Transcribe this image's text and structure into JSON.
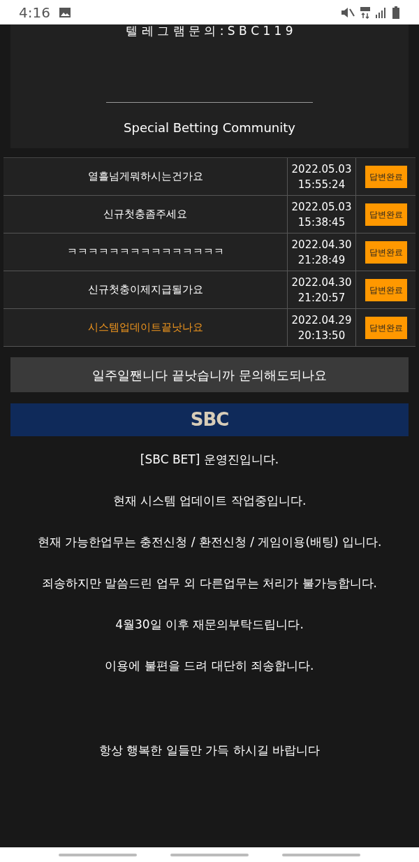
{
  "status_bar": {
    "time": "4:16"
  },
  "header": {
    "telegram": "텔 레 그 램 문 의 : S B C 1 1 9",
    "tagline": "Special Betting Community"
  },
  "inquiries": [
    {
      "title": "열흘넘게뭐하시는건가요",
      "date": "2022.05.03",
      "time": "15:55:24",
      "status": "답변완료",
      "selected": false
    },
    {
      "title": "신규첫충좀주세요",
      "date": "2022.05.03",
      "time": "15:38:45",
      "status": "답변완료",
      "selected": false
    },
    {
      "title": "ㅋㅋㅋㅋㅋㅋㅋㅋㅋㅋㅋㅋㅋㅋㅋ",
      "date": "2022.04.30",
      "time": "21:28:49",
      "status": "답변완료",
      "selected": false
    },
    {
      "title": "신규첫충이제지급될가요",
      "date": "2022.04.30",
      "time": "21:20:57",
      "status": "답변완료",
      "selected": false
    },
    {
      "title": "시스템업데이트끝낫나요",
      "date": "2022.04.29",
      "time": "20:13:50",
      "status": "답변완료",
      "selected": true
    }
  ],
  "question": "일주일짼니다 끝낫습니까 문의해도되나요",
  "banner": {
    "logo": "SBC"
  },
  "answer": [
    "[SBC BET] 운영진입니다.",
    "현재 시스템 업데이트 작업중입니다.",
    "현재 가능한업무는 충전신청 / 환전신청 / 게임이용(배팅) 입니다.",
    "죄송하지만 말씀드린 업무 외 다른업무는 처리가 불가능합니다.",
    "4월30일 이후 재문의부탁드립니다.",
    "이용에 불편을 드려 대단히 죄송합니다.",
    "항상 행복한 일들만 가득 하시길 바랍니다"
  ]
}
